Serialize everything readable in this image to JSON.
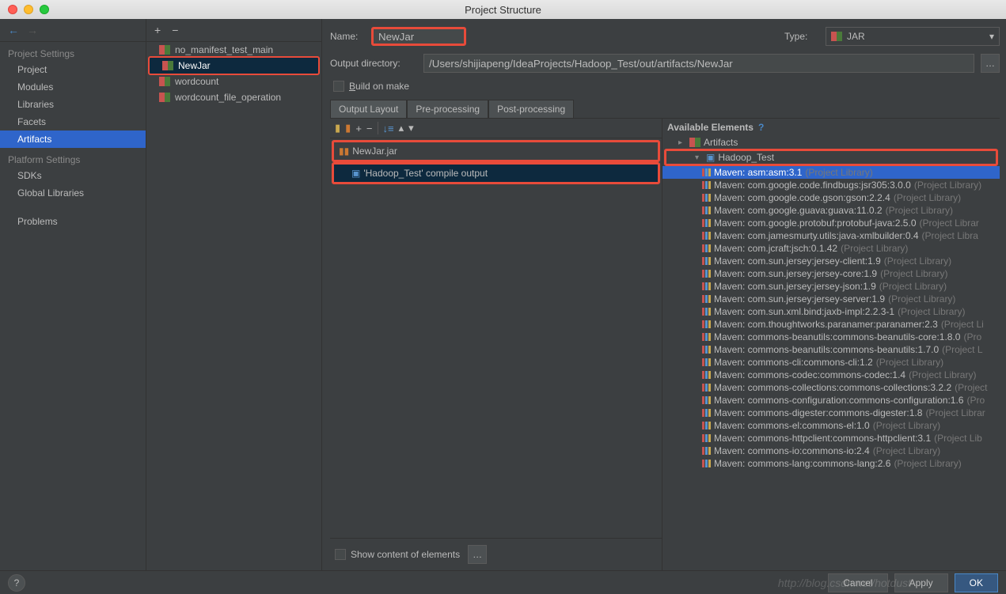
{
  "window": {
    "title": "Project Structure"
  },
  "sidebar": {
    "project_settings_header": "Project Settings",
    "project_items": [
      "Project",
      "Modules",
      "Libraries",
      "Facets",
      "Artifacts"
    ],
    "platform_settings_header": "Platform Settings",
    "platform_items": [
      "SDKs",
      "Global Libraries"
    ],
    "problems": "Problems"
  },
  "artifacts": {
    "items": [
      "no_manifest_test_main",
      "NewJar",
      "wordcount",
      "wordcount_file_operation"
    ],
    "selected_index": 1
  },
  "form": {
    "name_label": "Name:",
    "name_value": "NewJar",
    "type_label": "Type:",
    "type_value": "JAR",
    "output_dir_label": "Output directory:",
    "output_dir_value": "/Users/shijiapeng/IdeaProjects/Hadoop_Test/out/artifacts/NewJar",
    "build_on_make": "Build on make"
  },
  "tabs": [
    "Output Layout",
    "Pre-processing",
    "Post-processing"
  ],
  "output_tree": {
    "jar_name": "NewJar.jar",
    "compile_output": "'Hadoop_Test' compile output"
  },
  "available": {
    "header": "Available Elements",
    "root": "Artifacts",
    "module": "Hadoop_Test",
    "libs": [
      {
        "name": "Maven: asm:asm:3.1",
        "suffix": "(Project Library)",
        "selected": true
      },
      {
        "name": "Maven: com.google.code.findbugs:jsr305:3.0.0",
        "suffix": "(Project Library)"
      },
      {
        "name": "Maven: com.google.code.gson:gson:2.2.4",
        "suffix": "(Project Library)"
      },
      {
        "name": "Maven: com.google.guava:guava:11.0.2",
        "suffix": "(Project Library)"
      },
      {
        "name": "Maven: com.google.protobuf:protobuf-java:2.5.0",
        "suffix": "(Project Librar"
      },
      {
        "name": "Maven: com.jamesmurty.utils:java-xmlbuilder:0.4",
        "suffix": "(Project Libra"
      },
      {
        "name": "Maven: com.jcraft:jsch:0.1.42",
        "suffix": "(Project Library)"
      },
      {
        "name": "Maven: com.sun.jersey:jersey-client:1.9",
        "suffix": "(Project Library)"
      },
      {
        "name": "Maven: com.sun.jersey:jersey-core:1.9",
        "suffix": "(Project Library)"
      },
      {
        "name": "Maven: com.sun.jersey:jersey-json:1.9",
        "suffix": "(Project Library)"
      },
      {
        "name": "Maven: com.sun.jersey:jersey-server:1.9",
        "suffix": "(Project Library)"
      },
      {
        "name": "Maven: com.sun.xml.bind:jaxb-impl:2.2.3-1",
        "suffix": "(Project Library)"
      },
      {
        "name": "Maven: com.thoughtworks.paranamer:paranamer:2.3",
        "suffix": "(Project Li"
      },
      {
        "name": "Maven: commons-beanutils:commons-beanutils-core:1.8.0",
        "suffix": "(Pro"
      },
      {
        "name": "Maven: commons-beanutils:commons-beanutils:1.7.0",
        "suffix": "(Project L"
      },
      {
        "name": "Maven: commons-cli:commons-cli:1.2",
        "suffix": "(Project Library)"
      },
      {
        "name": "Maven: commons-codec:commons-codec:1.4",
        "suffix": "(Project Library)"
      },
      {
        "name": "Maven: commons-collections:commons-collections:3.2.2",
        "suffix": "(Project"
      },
      {
        "name": "Maven: commons-configuration:commons-configuration:1.6",
        "suffix": "(Pro"
      },
      {
        "name": "Maven: commons-digester:commons-digester:1.8",
        "suffix": "(Project Librar"
      },
      {
        "name": "Maven: commons-el:commons-el:1.0",
        "suffix": "(Project Library)"
      },
      {
        "name": "Maven: commons-httpclient:commons-httpclient:3.1",
        "suffix": "(Project Lib"
      },
      {
        "name": "Maven: commons-io:commons-io:2.4",
        "suffix": "(Project Library)"
      },
      {
        "name": "Maven: commons-lang:commons-lang:2.6",
        "suffix": "(Project Library)"
      }
    ]
  },
  "show_content": "Show content of elements",
  "footer": {
    "cancel": "Cancel",
    "apply": "Apply",
    "ok": "OK"
  },
  "watermark": "http://blog.csdn.net/hotdust"
}
